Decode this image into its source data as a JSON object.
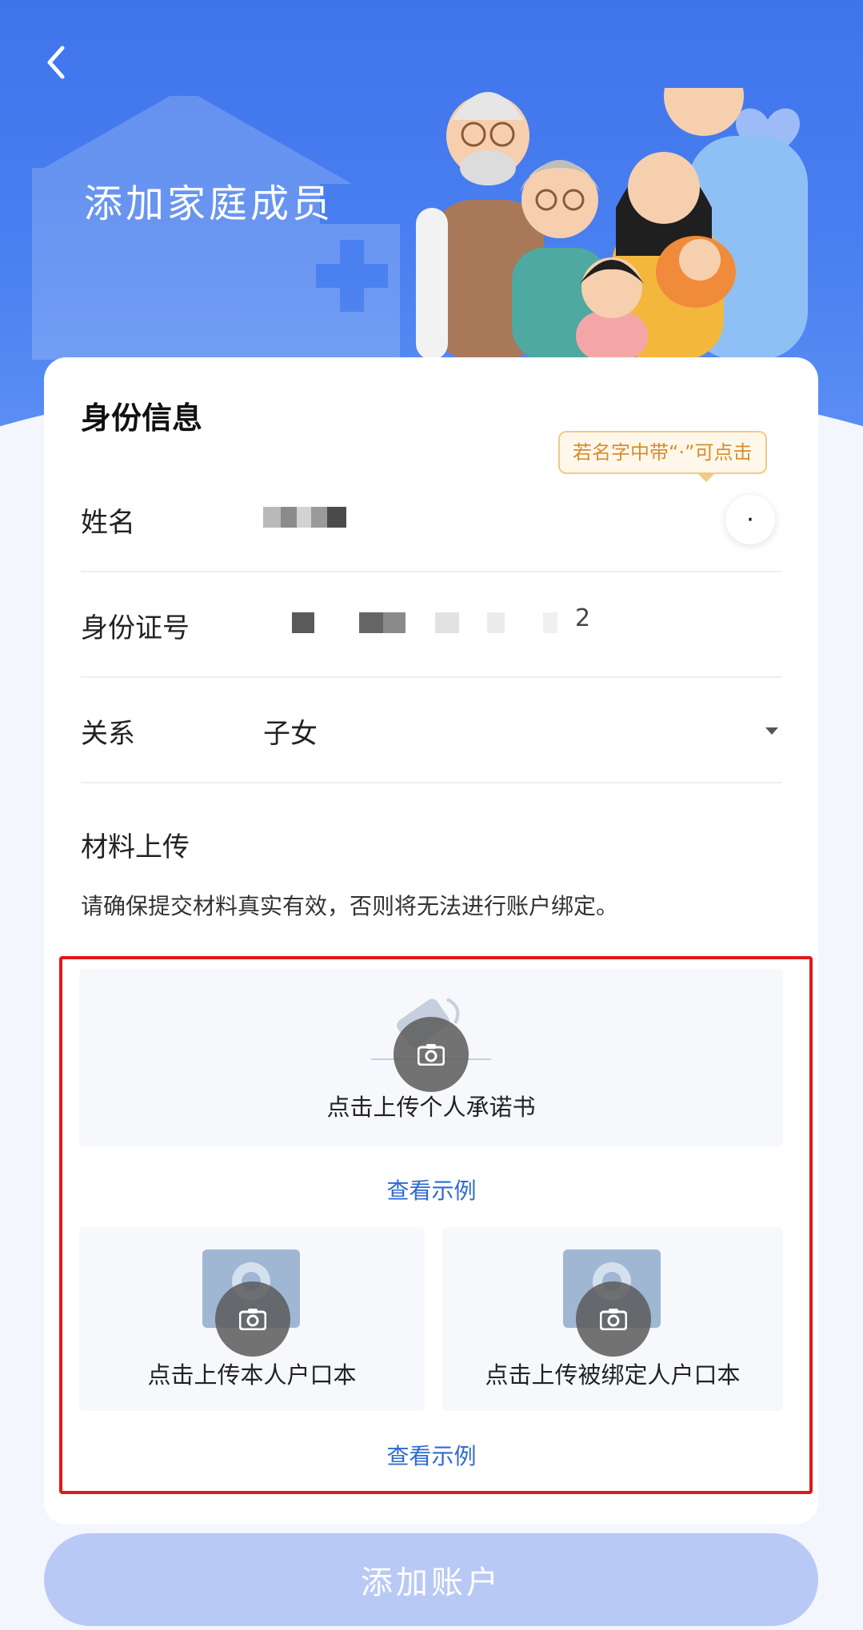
{
  "header": {
    "title": "添加家庭成员"
  },
  "identity": {
    "section_title": "身份信息",
    "tip": "若名字中带“·”可点击",
    "dot_button": "·",
    "name_label": "姓名",
    "id_label": "身份证号",
    "id_visible_char": "2",
    "relation_label": "关系",
    "relation_value": "子女"
  },
  "upload": {
    "title": "材料上传",
    "hint": "请确保提交材料真实有效，否则将无法进行账户绑定。",
    "pledge_label": "点击上传个人承诺书",
    "example_1": "查看示例",
    "own_hukou_label": "点击上传本人户口本",
    "bound_hukou_label": "点击上传被绑定人户口本",
    "example_2": "查看示例"
  },
  "footer": {
    "submit_label": "添加账户"
  },
  "colors": {
    "header_blue": "#4a80f0",
    "button_disabled": "#b9c9f5",
    "highlight_frame": "#e0181b",
    "tip_orange": "#d98d2b",
    "link_blue": "#2f6bd0"
  }
}
